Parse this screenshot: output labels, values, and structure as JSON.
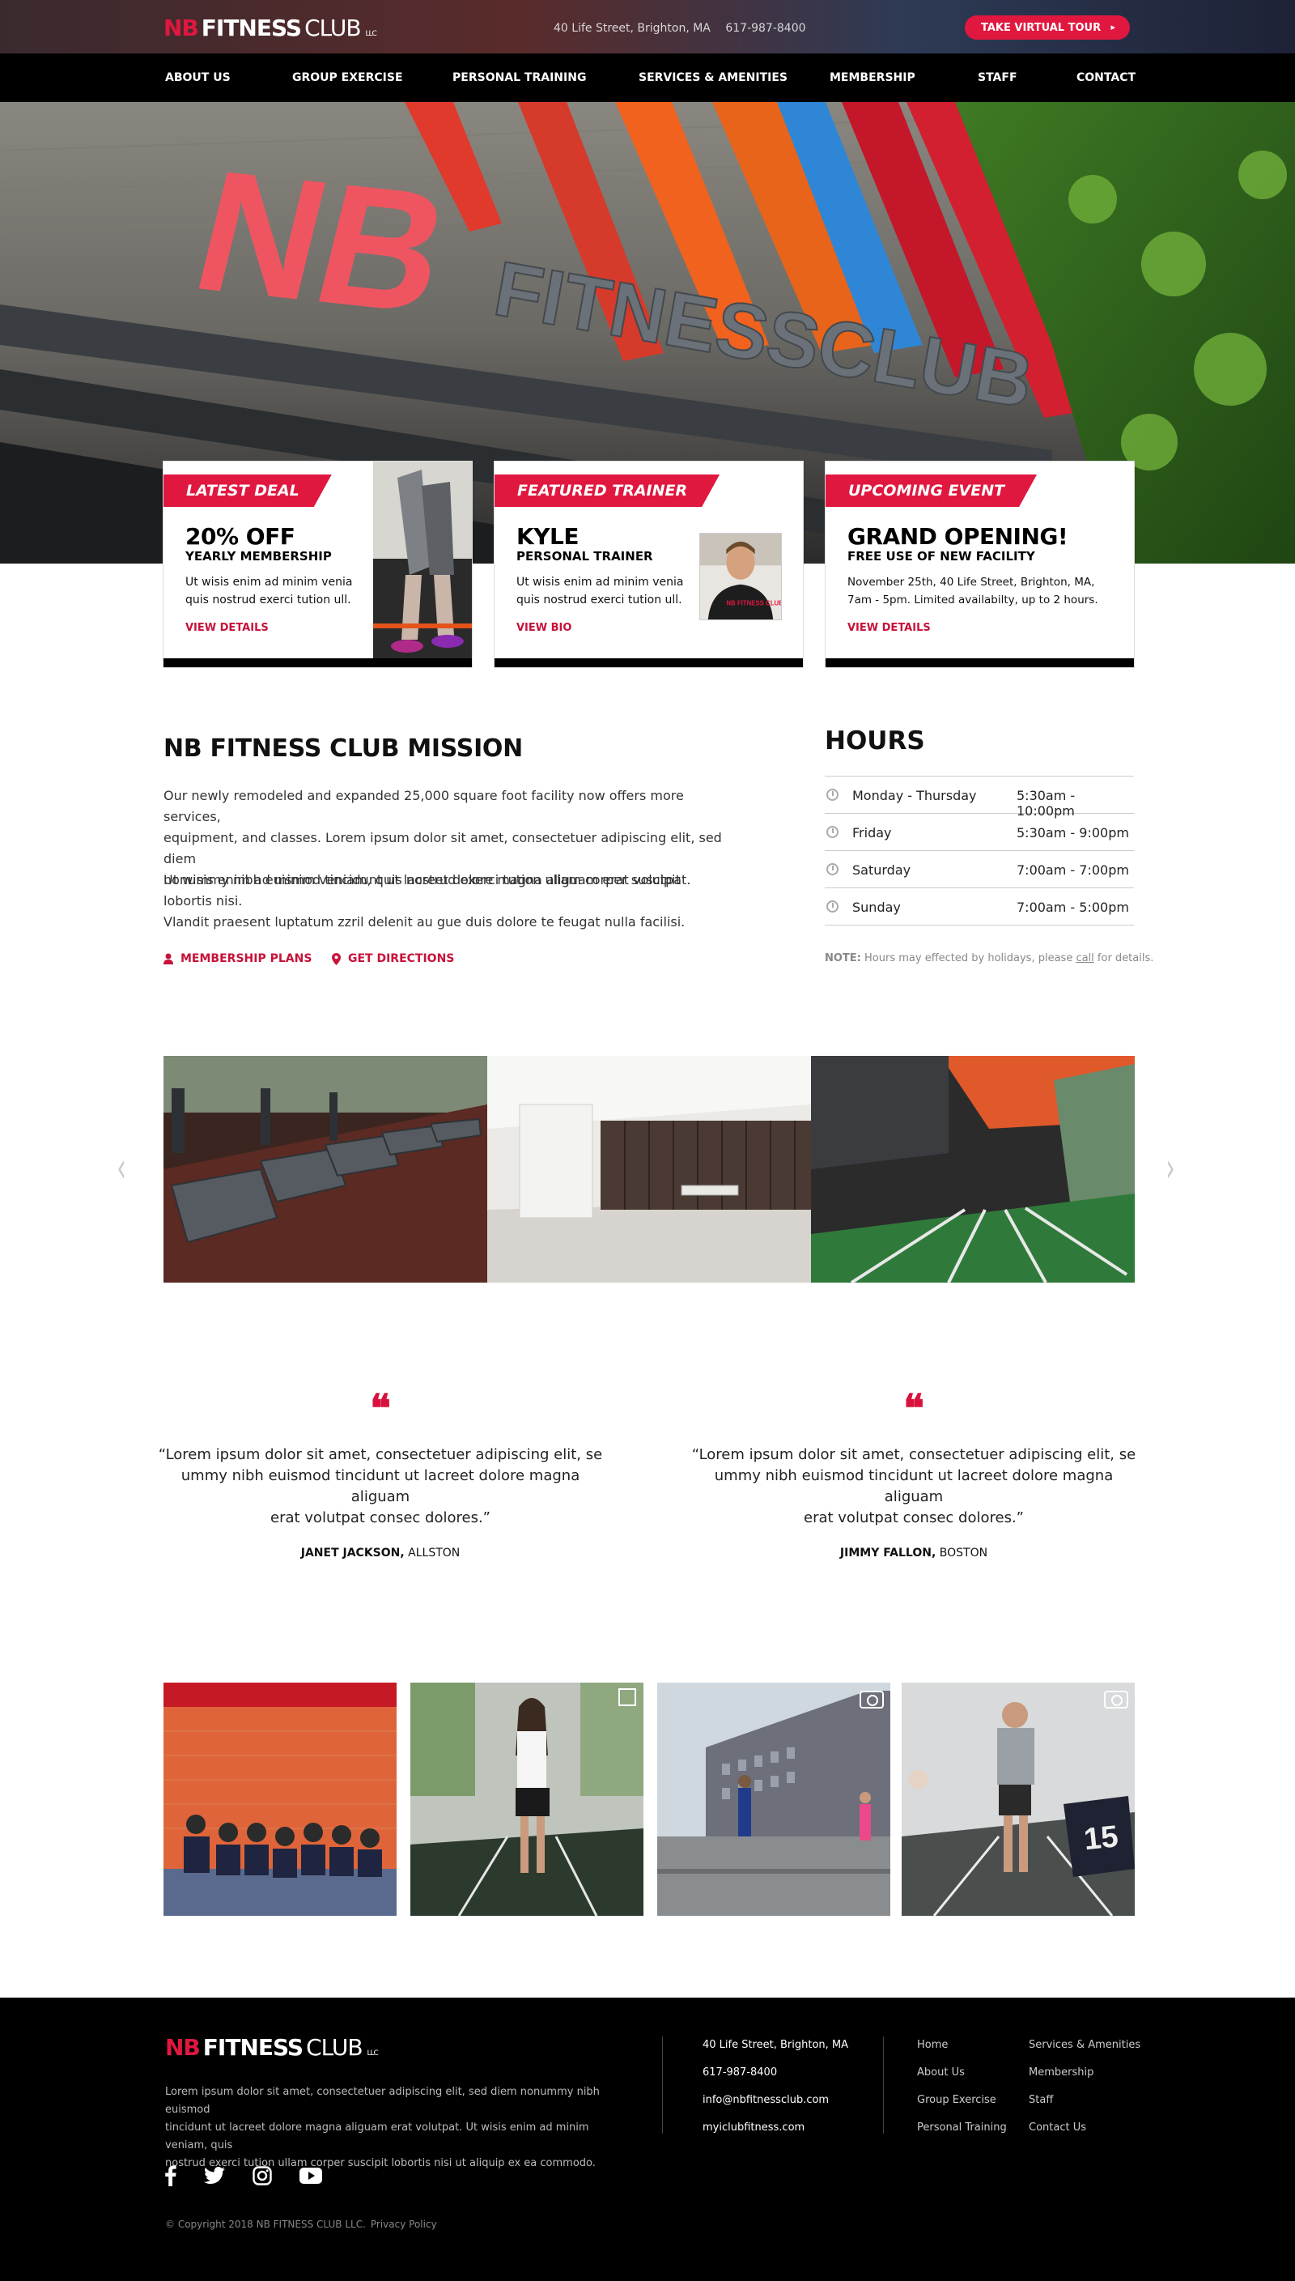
{
  "header": {
    "logo": {
      "nb": "NB",
      "fitness": "FITNESS",
      "club": "CLUB",
      "llc": "LLC"
    },
    "address": "40 Life Street, Brighton, MA",
    "phone": "617-987-8400",
    "tour_button": "TAKE VIRTUAL TOUR",
    "tour_arrow": "▸"
  },
  "nav": {
    "items": [
      {
        "label": "ABOUT US"
      },
      {
        "label": "GROUP EXERCISE"
      },
      {
        "label": "PERSONAL TRAINING"
      },
      {
        "label": "SERVICES & AMENITIES"
      },
      {
        "label": "MEMBERSHIP"
      },
      {
        "label": "STAFF"
      },
      {
        "label": "CONTACT"
      }
    ]
  },
  "hero": {
    "sign_nb": "NB",
    "sign_text": "FITNESSCLUB"
  },
  "cards": [
    {
      "ribbon": "LATEST DEAL",
      "title": "20% OFF",
      "subtitle": "YEARLY MEMBERSHIP",
      "body_line1": "Ut wisis enim ad minim venia",
      "body_line2": "quis nostrud exerci tution ull.",
      "link": "VIEW DETAILS"
    },
    {
      "ribbon": "FEATURED TRAINER",
      "title": "KYLE",
      "subtitle": "PERSONAL TRAINER",
      "body_line1": "Ut wisis enim ad minim venia",
      "body_line2": "quis nostrud exerci tution ull.",
      "link": "VIEW BIO",
      "shirt_text": "NB FITNESS CLUB"
    },
    {
      "ribbon": "UPCOMING EVENT",
      "title": "GRAND OPENING!",
      "subtitle": "FREE USE OF NEW FACILITY",
      "body_line1": "November 25th, 40 Life Street, Brighton, MA,",
      "body_line2": "7am - 5pm. Limited availabilty, up to 2 hours.",
      "link": "VIEW DETAILS"
    }
  ],
  "mission": {
    "title": "NB FITNESS CLUB MISSION",
    "para1_line1": "Our newly remodeled and expanded 25,000 square foot facility now offers more services,",
    "para1_line2": "equipment, and classes. Lorem ipsum dolor sit amet, consectetuer adipiscing elit, sed diem",
    "para1_line3": "nonummy nibh euismod tincidunt ut lacreet dolore magna aliguam erat volutpat.",
    "para2_line1": "Ut wisis enim ad minim veniam, quis nostrud exerci tution ullam corper suscipit lobortis nisi.",
    "para2_line2": "Vlandit praesent luptatum zzril delenit au gue duis dolore te feugat nulla facilisi.",
    "link_membership": "MEMBERSHIP PLANS",
    "link_directions": "GET DIRECTIONS"
  },
  "hours": {
    "title": "HOURS",
    "rows": [
      {
        "day": "Monday - Thursday",
        "time": "5:30am - 10:00pm"
      },
      {
        "day": "Friday",
        "time": "5:30am - 9:00pm"
      },
      {
        "day": "Saturday",
        "time": "7:00am - 7:00pm"
      },
      {
        "day": "Sunday",
        "time": "7:00am - 5:00pm"
      }
    ],
    "note_label": "NOTE:",
    "note_text": " Hours may effected by holidays, please ",
    "note_link": "call",
    "note_end": " for details."
  },
  "gallery": {
    "prev": "‹",
    "next": "›"
  },
  "testimonials": [
    {
      "quote_mark": "❝",
      "line1": "“Lorem ipsum dolor sit amet, consectetuer adipiscing elit, se",
      "line2": "ummy nibh euismod tincidunt ut lacreet dolore magna aliguam",
      "line3": "erat volutpat consec dolores.”",
      "name": "JANET JACKSON,",
      "place": " ALLSTON"
    },
    {
      "quote_mark": "❝",
      "line1": "“Lorem ipsum dolor sit amet, consectetuer adipiscing elit, se",
      "line2": "ummy nibh euismod tincidunt ut lacreet dolore magna aliguam",
      "line3": "erat volutpat consec dolores.”",
      "name": "JIMMY FALLON,",
      "place": " BOSTON"
    }
  ],
  "footer": {
    "logo": {
      "nb": "NB",
      "fitness": "FITNESS",
      "club": "CLUB",
      "llc": "LLC"
    },
    "desc_line1": "Lorem ipsum dolor sit amet, consectetuer adipiscing elit, sed diem nonummy nibh euismod",
    "desc_line2": "tincidunt ut lacreet dolore magna aliguam erat volutpat. Ut wisis enim ad minim veniam, quis",
    "desc_line3": "nostrud exerci tution ullam corper suscipit lobortis nisi ut aliquip ex ea commodo.",
    "address": "40 Life Street, Brighton, MA",
    "phone": "617-987-8400",
    "email": "info@nbfitnessclub.com",
    "site": "myiclubfitness.com",
    "links_col1": [
      "Home",
      "About Us",
      "Group Exercise",
      "Personal Training"
    ],
    "links_col2": [
      "Services & Amenities",
      "Membership",
      "Staff",
      "Contact Us"
    ],
    "social_icons": [
      "facebook-icon",
      "twitter-icon",
      "instagram-icon",
      "youtube-icon"
    ],
    "copyright": "© Copyright 2018  NB FITNESS CLUB LLC.",
    "privacy": "Privacy Policy"
  },
  "colors": {
    "brand_red": "#e0173f",
    "black": "#000000"
  }
}
